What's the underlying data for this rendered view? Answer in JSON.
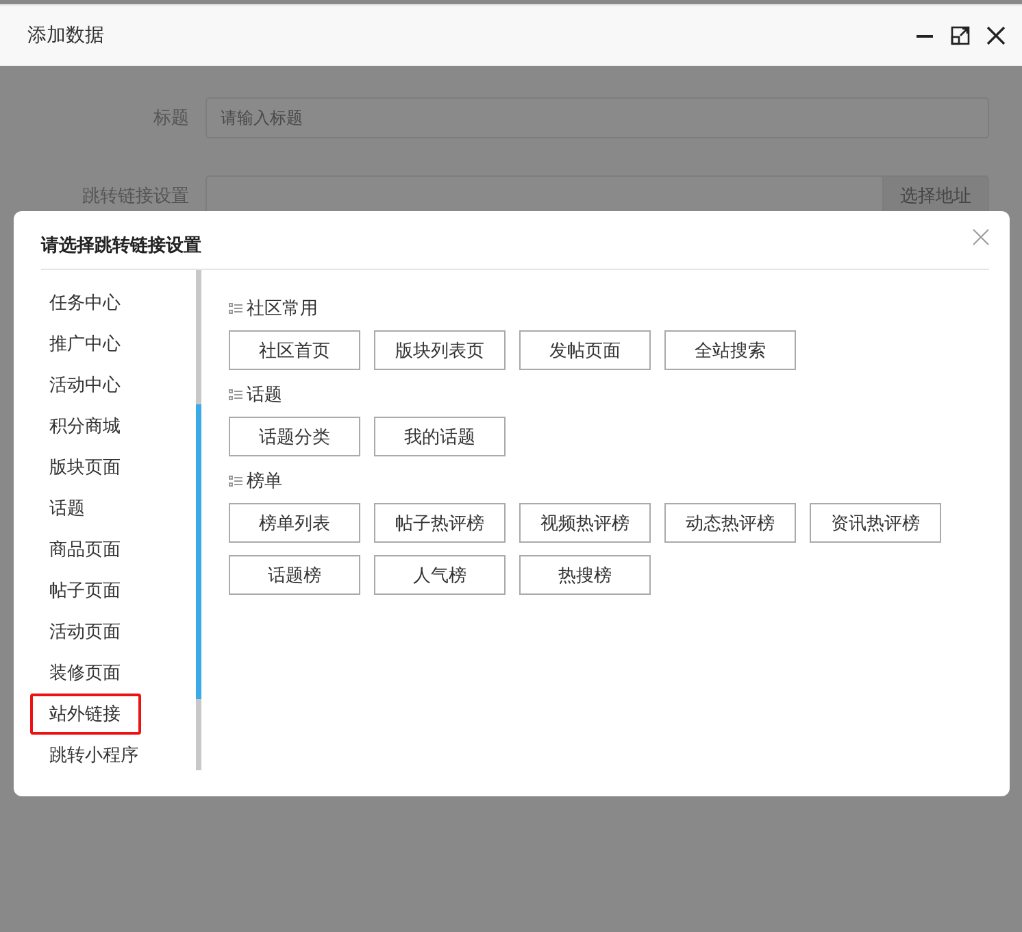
{
  "window": {
    "title": "添加数据"
  },
  "form": {
    "fields": [
      {
        "label": "标题",
        "placeholder": "请输入标题"
      },
      {
        "label": "跳转链接设置",
        "button": "选择地址"
      }
    ]
  },
  "dialog": {
    "title": "请选择跳转链接设置",
    "sidebar": {
      "items": [
        {
          "label": "任务中心",
          "selected": false
        },
        {
          "label": "推广中心",
          "selected": false
        },
        {
          "label": "活动中心",
          "selected": false
        },
        {
          "label": "积分商城",
          "selected": false
        },
        {
          "label": "版块页面",
          "selected": false
        },
        {
          "label": "话题",
          "selected": false
        },
        {
          "label": "商品页面",
          "selected": false
        },
        {
          "label": "帖子页面",
          "selected": false
        },
        {
          "label": "活动页面",
          "selected": false
        },
        {
          "label": "装修页面",
          "selected": false
        },
        {
          "label": "站外链接",
          "selected": true
        },
        {
          "label": "跳转小程序",
          "selected": false
        }
      ]
    },
    "sections": [
      {
        "title": "社区常用",
        "links": [
          "社区首页",
          "版块列表页",
          "发帖页面",
          "全站搜索"
        ]
      },
      {
        "title": "话题",
        "links": [
          "话题分类",
          "我的话题"
        ]
      },
      {
        "title": "榜单",
        "links": [
          "榜单列表",
          "帖子热评榜",
          "视频热评榜",
          "动态热评榜",
          "资讯热评榜",
          "话题榜",
          "人气榜",
          "热搜榜"
        ]
      }
    ]
  }
}
